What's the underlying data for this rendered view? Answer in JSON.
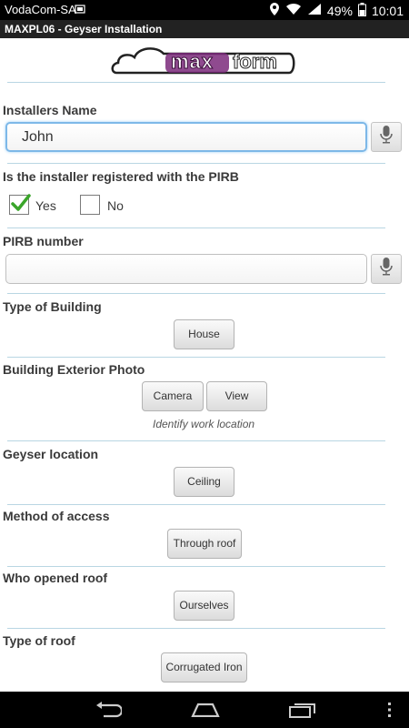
{
  "status_bar": {
    "carrier": "VodaCom-SA",
    "battery": "49%",
    "time": "10:01"
  },
  "app": {
    "title": "MAXPL06 - Geyser Installation",
    "logo_max": "max",
    "logo_form": "form"
  },
  "form": {
    "installers_name": {
      "label": "Installers Name",
      "value": "John"
    },
    "pirb_registered": {
      "label": "Is the installer registered with the PIRB",
      "yes": "Yes",
      "no": "No",
      "selected": "Yes"
    },
    "pirb_number": {
      "label": "PIRB number",
      "value": ""
    },
    "type_of_building": {
      "label": "Type of Building",
      "value": "House"
    },
    "exterior_photo": {
      "label": "Building Exterior Photo",
      "camera": "Camera",
      "view": "View",
      "hint": "Identify work location"
    },
    "geyser_location": {
      "label": "Geyser location",
      "value": "Ceiling"
    },
    "method_of_access": {
      "label": "Method of access",
      "value": "Through roof"
    },
    "who_opened_roof": {
      "label": "Who opened roof",
      "value": "Ourselves"
    },
    "type_of_roof": {
      "label": "Type of roof",
      "value": "Corrugated Iron"
    }
  },
  "colors": {
    "logo_accent": "#7b2a7b",
    "divider": "#b9d6e3",
    "focus": "#7db8e8",
    "check": "#3aa52a"
  }
}
